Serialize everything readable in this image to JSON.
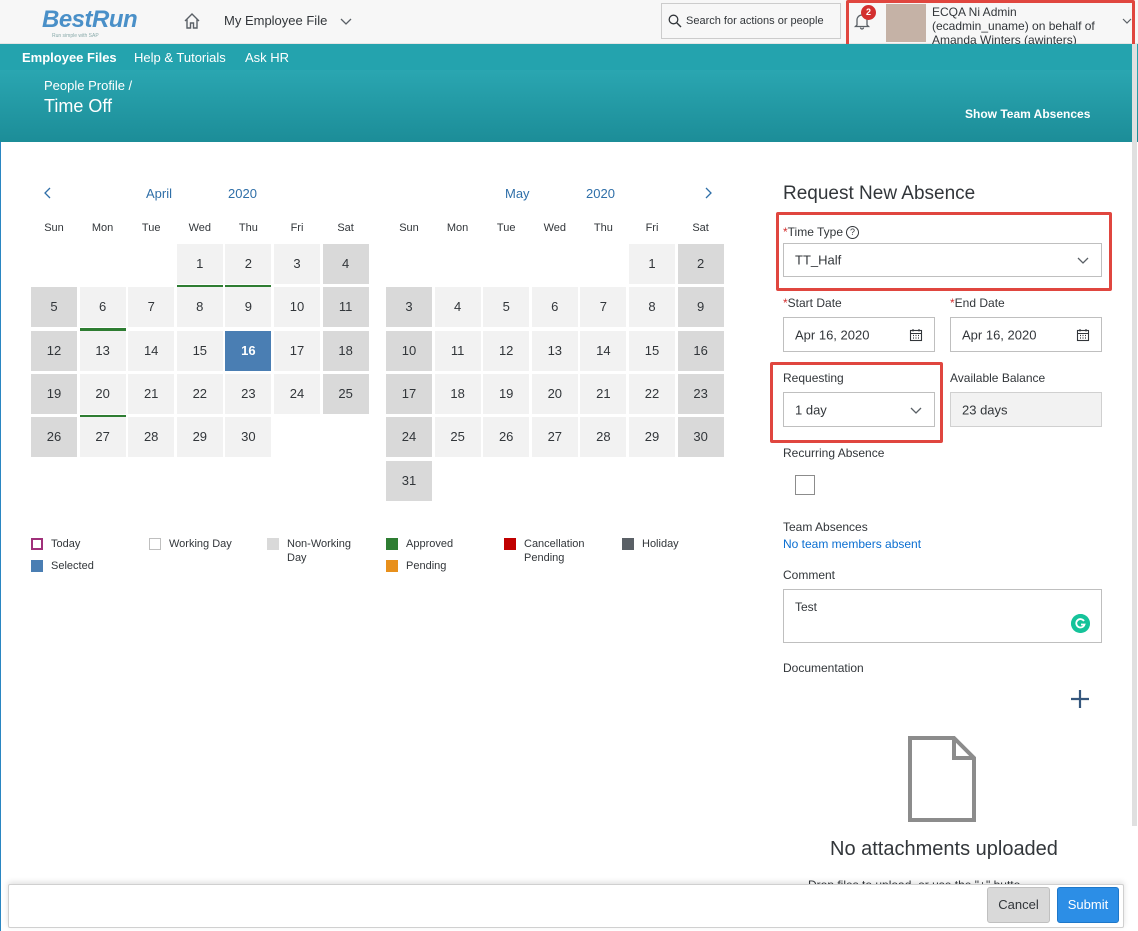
{
  "shell": {
    "logo": "BestRun",
    "logo_tagline": "Run simple with SAP",
    "module": "My Employee File",
    "search_placeholder": "Search for actions or people",
    "notification_count": "2",
    "user_line1": "ECQA Ni Admin",
    "user_line2": "(ecadmin_uname) on behalf of",
    "user_line3": "Amanda Winters (awinters)"
  },
  "subnav": [
    "Employee Files",
    "Help & Tutorials",
    "Ask HR"
  ],
  "header": {
    "breadcrumb": "People Profile /",
    "title": "Time Off",
    "team_absences_link": "Show Team Absences"
  },
  "calendar": {
    "weekdays": [
      "Sun",
      "Mon",
      "Tue",
      "Wed",
      "Thu",
      "Fri",
      "Sat"
    ],
    "april": {
      "month": "April",
      "year": "2020",
      "first_weekday": 3,
      "days": 30,
      "approved": [
        1,
        2,
        6,
        20
      ],
      "selected": 16
    },
    "may": {
      "month": "May",
      "year": "2020",
      "first_weekday": 5,
      "days": 31,
      "approved": [],
      "selected": null
    }
  },
  "legend": [
    {
      "label": "Today",
      "color": "#ffffff",
      "border": "#a0307a"
    },
    {
      "label": "Working Day",
      "color": "#ffffff",
      "border": "#bfbfbf"
    },
    {
      "label": "Non-Working Day",
      "color": "#d9d9d9",
      "border": "#d9d9d9"
    },
    {
      "label": "Approved",
      "color": "#2e7d32",
      "border": "#2e7d32"
    },
    {
      "label": "Cancellation Pending",
      "color": "#c00000",
      "border": "#c00000"
    },
    {
      "label": "Holiday",
      "color": "#5a6066",
      "border": "#5a6066"
    },
    {
      "label": "Selected",
      "color": "#4a7eb3",
      "border": "#4a7eb3"
    },
    {
      "label": "Pending",
      "color": "#e8901c",
      "border": "#e8901c"
    }
  ],
  "form": {
    "title": "Request New Absence",
    "time_type_label": "Time Type",
    "time_type_value": "TT_Half",
    "start_date_label": "Start Date",
    "start_date_value": "Apr 16, 2020",
    "end_date_label": "End Date",
    "end_date_value": "Apr 16, 2020",
    "requesting_label": "Requesting",
    "requesting_value": "1 day",
    "available_balance_label": "Available Balance",
    "available_balance_value": "23 days",
    "recurring_label": "Recurring Absence",
    "team_absences_label": "Team Absences",
    "team_absences_value": "No team members absent",
    "comment_label": "Comment",
    "comment_value": "Test",
    "documentation_label": "Documentation",
    "no_attachments": "No attachments uploaded",
    "drop_hint": "Drop files to upload, or use the \"+\" butto"
  },
  "footer": {
    "cancel": "Cancel",
    "submit": "Submit"
  }
}
